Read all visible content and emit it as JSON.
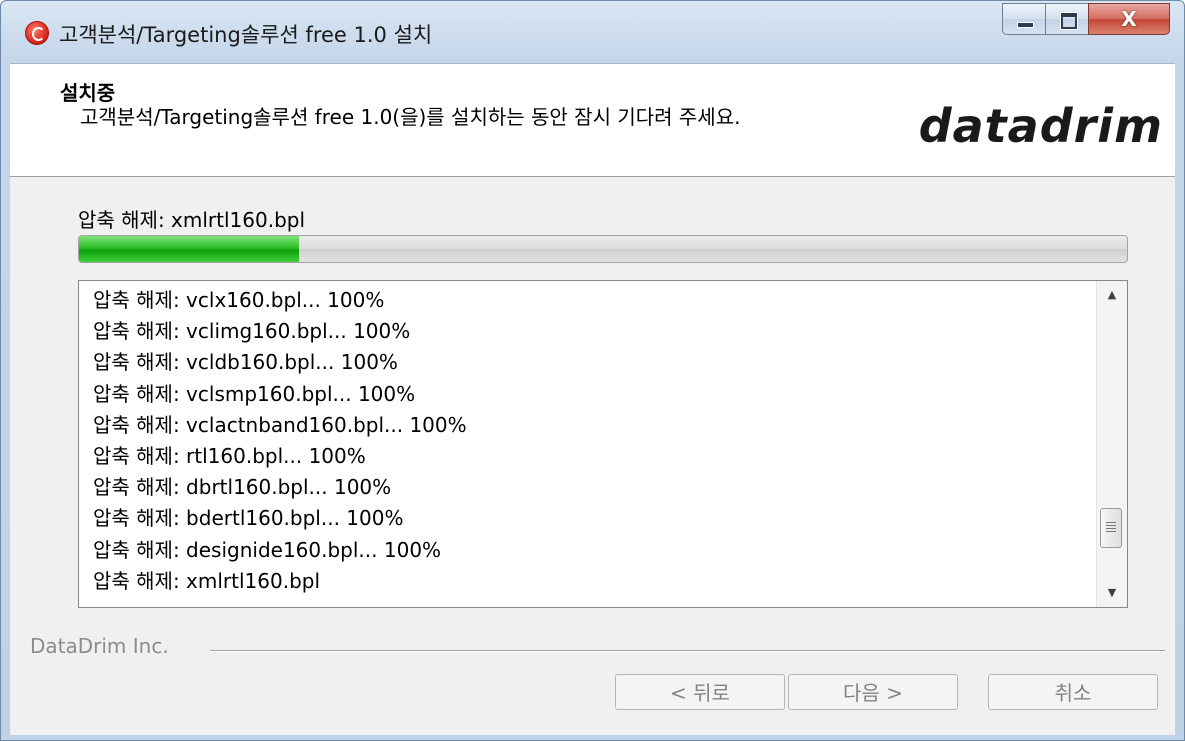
{
  "window": {
    "title": "고객분석/Targeting솔루션 free 1.0 설치",
    "close_glyph": "X"
  },
  "header": {
    "title": "설치중",
    "description": "고객분석/Targeting솔루션 free 1.0(을)를 설치하는 동안 잠시 기다려 주세요.",
    "logo_left": "data",
    "logo_right": "drim"
  },
  "install": {
    "status_label": "압축 해제: xmlrtl160.bpl",
    "progress_fraction": 0.21
  },
  "log": {
    "lines": [
      "압축 해제: vclx160.bpl... 100%",
      "압축 해제: vclimg160.bpl... 100%",
      "압축 해제: vcldb160.bpl... 100%",
      "압축 해제: vclsmp160.bpl... 100%",
      "압축 해제: vclactnband160.bpl... 100%",
      "압축 해제: rtl160.bpl... 100%",
      "압축 해제: dbrtl160.bpl... 100%",
      "압축 해제: bdertl160.bpl... 100%",
      "압축 해제: designide160.bpl... 100%",
      "압축 해제: xmlrtl160.bpl"
    ],
    "scroll_fraction": 0.95
  },
  "footer": {
    "brand": "DataDrim Inc.",
    "back_label": "< 뒤로",
    "next_label": "다음 >",
    "cancel_label": "취소"
  },
  "colors": {
    "progress_green": "#2fc02a",
    "brand_red": "#c8102e"
  }
}
